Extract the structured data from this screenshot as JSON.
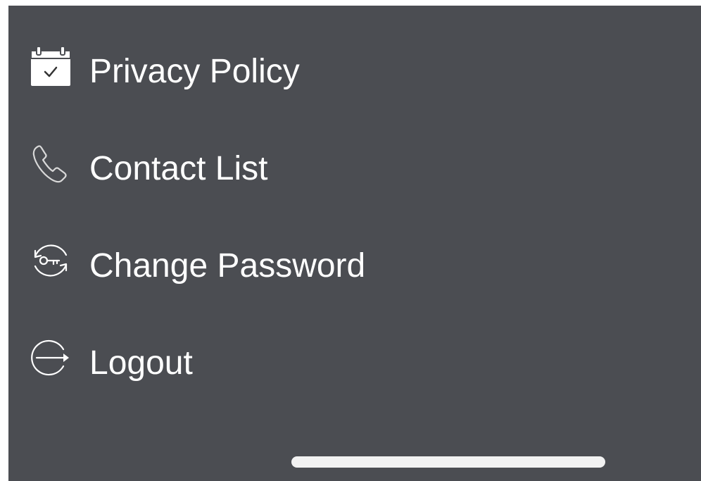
{
  "menu": {
    "background_color": "#4b4d52",
    "items": [
      {
        "label": "Privacy Policy",
        "icon": "calendar-check-icon"
      },
      {
        "label": "Contact List",
        "icon": "phone-icon"
      },
      {
        "label": "Change Password",
        "icon": "key-refresh-icon"
      },
      {
        "label": "Logout",
        "icon": "logout-icon"
      }
    ]
  },
  "home_indicator": {
    "color": "#f2f2f2"
  }
}
